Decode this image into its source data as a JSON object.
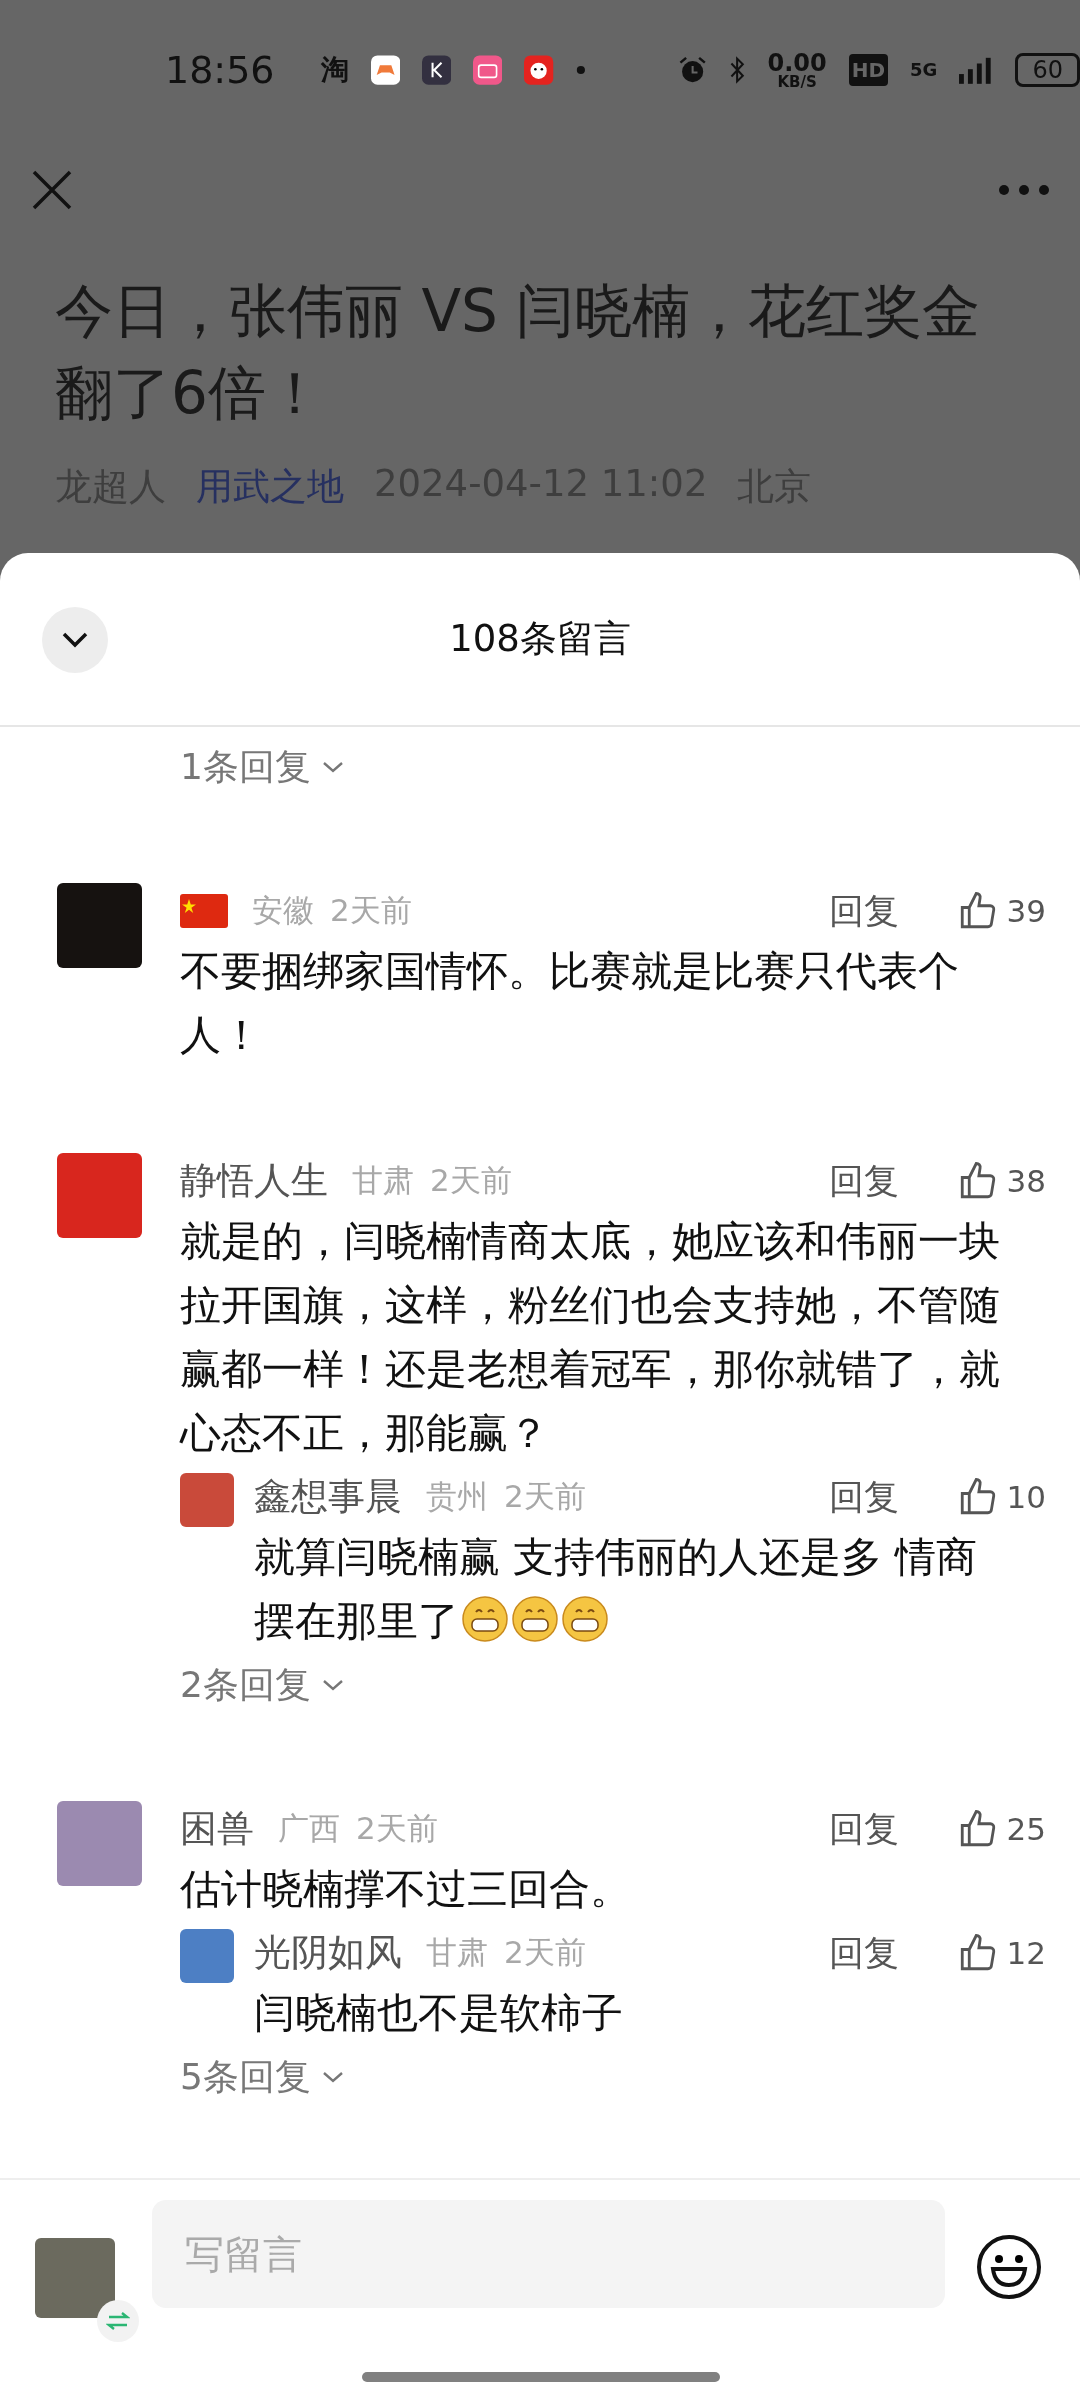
{
  "status_bar": {
    "time": "18:56",
    "app_badge": "淘",
    "speed_value": "0.00",
    "speed_unit": "KB/S",
    "hd": "HD",
    "network": "5G",
    "battery": "60"
  },
  "article": {
    "title": "今日，张伟丽 VS 闫晓楠，花红奖金翻了6倍！",
    "author": "龙超人",
    "channel": "用武之地",
    "date": "2024-04-12 11:02",
    "location": "北京"
  },
  "sheet": {
    "title": "108条留言",
    "top_more_replies": "1条回复",
    "comments": [
      {
        "kind": "flag",
        "region": "安徽",
        "time": "2天前",
        "reply": "回复",
        "likes": "39",
        "text": "不要捆绑家国情怀。比赛就是比赛只代表个人！"
      },
      {
        "kind": "named",
        "name": "静悟人生",
        "region": "甘肃",
        "time": "2天前",
        "reply": "回复",
        "likes": "38",
        "text": "就是的，闫晓楠情商太底，她应该和伟丽一块拉开国旗，这样，粉丝们也会支持她，不管随赢都一样！还是老想着冠军，那你就错了，就心态不正，那能赢？",
        "replies": [
          {
            "name": "鑫想事晨",
            "region": "贵州",
            "time": "2天前",
            "reply": "回复",
            "likes": "10",
            "text": "就算闫晓楠赢  支持伟丽的人还是多  情商摆在那里了",
            "emojis": [
              {
                "kind": "grin"
              },
              {
                "kind": "grin"
              },
              {
                "kind": "grin"
              }
            ]
          }
        ],
        "more_replies": "2条回复"
      },
      {
        "kind": "named",
        "name": "困兽",
        "region": "广西",
        "time": "2天前",
        "reply": "回复",
        "likes": "25",
        "text": "估计晓楠撑不过三回合。",
        "replies": [
          {
            "name": "光阴如风",
            "region": "甘肃",
            "time": "2天前",
            "reply": "回复",
            "likes": "12",
            "text": "闫晓楠也不是软柿子"
          }
        ],
        "more_replies": "5条回复"
      }
    ]
  },
  "composer": {
    "placeholder": "写留言"
  }
}
